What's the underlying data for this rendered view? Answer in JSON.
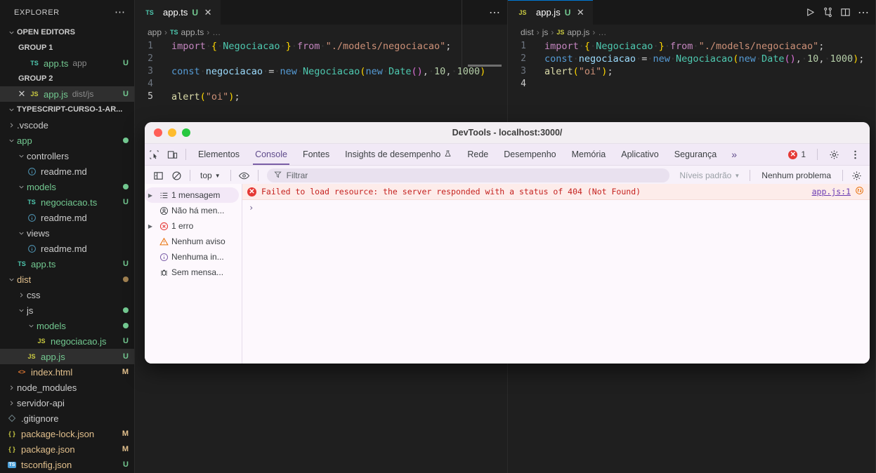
{
  "sidebar": {
    "title": "EXPLORER",
    "more_label": "⋯",
    "open_editors": {
      "label": "OPEN EDITORS",
      "groups": [
        {
          "label": "GROUP 1",
          "items": [
            {
              "icon": "ts-file-icon",
              "name": "app.ts",
              "path": "app",
              "badge": "U"
            }
          ]
        },
        {
          "label": "GROUP 2",
          "items": [
            {
              "icon": "js-file-icon",
              "name": "app.js",
              "path": "dist/js",
              "badge": "U",
              "close": "✕"
            }
          ]
        }
      ]
    },
    "project": {
      "label": "TYPESCRIPT-CURSO-1-AR...",
      "tree": [
        {
          "depth": 1,
          "kind": "folder",
          "collapsed": true,
          "name": ".vscode",
          "color": "plain",
          "badge": "",
          "dot": ""
        },
        {
          "depth": 1,
          "kind": "folder",
          "collapsed": false,
          "name": "app",
          "color": "green",
          "badge": "",
          "dot": "#73c991"
        },
        {
          "depth": 2,
          "kind": "folder",
          "collapsed": false,
          "name": "controllers",
          "color": "plain",
          "badge": "",
          "dot": ""
        },
        {
          "depth": 3,
          "kind": "md",
          "name": "readme.md",
          "color": "plain",
          "badge": "",
          "dot": ""
        },
        {
          "depth": 2,
          "kind": "folder",
          "collapsed": false,
          "name": "models",
          "color": "green",
          "badge": "",
          "dot": "#73c991"
        },
        {
          "depth": 3,
          "kind": "ts",
          "name": "negociacao.ts",
          "color": "green",
          "badge": "U",
          "dot": ""
        },
        {
          "depth": 3,
          "kind": "md",
          "name": "readme.md",
          "color": "plain",
          "badge": "",
          "dot": ""
        },
        {
          "depth": 2,
          "kind": "folder",
          "collapsed": false,
          "name": "views",
          "color": "plain",
          "badge": "",
          "dot": ""
        },
        {
          "depth": 3,
          "kind": "md",
          "name": "readme.md",
          "color": "plain",
          "badge": "",
          "dot": ""
        },
        {
          "depth": 2,
          "kind": "ts",
          "name": "app.ts",
          "color": "green",
          "badge": "U",
          "dot": ""
        },
        {
          "depth": 1,
          "kind": "folder",
          "collapsed": false,
          "name": "dist",
          "color": "orange",
          "badge": "",
          "dot": "#a08050"
        },
        {
          "depth": 2,
          "kind": "folder",
          "collapsed": true,
          "name": "css",
          "color": "plain",
          "badge": "",
          "dot": ""
        },
        {
          "depth": 2,
          "kind": "folder",
          "collapsed": false,
          "name": "js",
          "color": "plain",
          "badge": "",
          "dot": "#73c991"
        },
        {
          "depth": 3,
          "kind": "folder",
          "collapsed": false,
          "name": "models",
          "color": "green",
          "badge": "",
          "dot": "#73c991"
        },
        {
          "depth": 4,
          "kind": "js",
          "name": "negociacao.js",
          "color": "green",
          "badge": "U",
          "dot": ""
        },
        {
          "depth": 3,
          "kind": "js",
          "name": "app.js",
          "color": "green",
          "badge": "U",
          "dot": "",
          "selected": true
        },
        {
          "depth": 2,
          "kind": "html",
          "name": "index.html",
          "color": "orange",
          "badge": "M",
          "dot": ""
        },
        {
          "depth": 1,
          "kind": "folder",
          "collapsed": true,
          "name": "node_modules",
          "color": "plain",
          "badge": "",
          "dot": ""
        },
        {
          "depth": 1,
          "kind": "folder",
          "collapsed": true,
          "name": "servidor-api",
          "color": "plain",
          "badge": "",
          "dot": ""
        },
        {
          "depth": 1,
          "kind": "git",
          "name": ".gitignore",
          "color": "plain",
          "badge": "",
          "dot": ""
        },
        {
          "depth": 1,
          "kind": "json",
          "name": "package-lock.json",
          "color": "orange",
          "badge": "M",
          "dot": ""
        },
        {
          "depth": 1,
          "kind": "json",
          "name": "package.json",
          "color": "orange",
          "badge": "M",
          "dot": ""
        },
        {
          "depth": 1,
          "kind": "tsconf",
          "name": "tsconfig.json",
          "color": "orange",
          "badge": "U",
          "dot": ""
        }
      ]
    }
  },
  "editor_left": {
    "tab": {
      "icon": "ts-file-icon",
      "name": "app.ts",
      "badge": "U",
      "close": "✕"
    },
    "more_label": "⋯",
    "breadcrumb": [
      "app",
      "app.ts",
      "…"
    ],
    "lines": [
      {
        "n": "1",
        "tokens": [
          {
            "t": "import",
            "c": "k-import"
          },
          {
            "t": "·",
            "c": "ws"
          },
          {
            "t": "{",
            "c": "br-y"
          },
          {
            "t": "·",
            "c": "ws"
          },
          {
            "t": "Negociacao",
            "c": "id-cls"
          },
          {
            "t": "·",
            "c": "ws"
          },
          {
            "t": "}",
            "c": "br-y"
          },
          {
            "t": "·",
            "c": "ws"
          },
          {
            "t": "from",
            "c": "k-import"
          },
          {
            "t": "·",
            "c": "ws"
          },
          {
            "t": "\"./models/negociacao\"",
            "c": "str"
          },
          {
            "t": ";",
            "c": "punc"
          }
        ]
      },
      {
        "n": "2",
        "tokens": []
      },
      {
        "n": "3",
        "tokens": [
          {
            "t": "const",
            "c": "k-const"
          },
          {
            "t": "·",
            "c": "ws"
          },
          {
            "t": "negociacao",
            "c": "id-var"
          },
          {
            "t": "·",
            "c": "ws"
          },
          {
            "t": "=",
            "c": "punc"
          },
          {
            "t": "·",
            "c": "ws"
          },
          {
            "t": "new",
            "c": "k-new"
          },
          {
            "t": "·",
            "c": "ws"
          },
          {
            "t": "Negociacao",
            "c": "id-cls"
          },
          {
            "t": "(",
            "c": "br-y"
          },
          {
            "t": "new",
            "c": "k-new"
          },
          {
            "t": "·",
            "c": "ws"
          },
          {
            "t": "Date",
            "c": "id-cls"
          },
          {
            "t": "(",
            "c": "br-p"
          },
          {
            "t": ")",
            "c": "br-p"
          },
          {
            "t": ",",
            "c": "punc"
          },
          {
            "t": "·",
            "c": "ws"
          },
          {
            "t": "10",
            "c": "num"
          },
          {
            "t": ",",
            "c": "punc"
          },
          {
            "t": "·",
            "c": "ws"
          },
          {
            "t": "1000",
            "c": "num"
          },
          {
            "t": ")",
            "c": "br-y"
          }
        ]
      },
      {
        "n": "4",
        "tokens": []
      },
      {
        "n": "5",
        "cur": true,
        "tokens": [
          {
            "t": "alert",
            "c": "fn"
          },
          {
            "t": "(",
            "c": "br-y"
          },
          {
            "t": "\"oi\"",
            "c": "str"
          },
          {
            "t": ")",
            "c": "br-y"
          },
          {
            "t": ";",
            "c": "punc"
          }
        ]
      }
    ]
  },
  "editor_right": {
    "tab": {
      "icon": "js-file-icon",
      "name": "app.js",
      "badge": "U",
      "close": "✕"
    },
    "actions": [
      "run-icon",
      "source-control-icon",
      "split-editor-icon",
      "more-actions-icon"
    ],
    "breadcrumb": [
      "dist",
      "js",
      "app.js",
      "…"
    ],
    "lines": [
      {
        "n": "1",
        "tokens": [
          {
            "t": "import",
            "c": "k-import"
          },
          {
            "t": "·",
            "c": "ws"
          },
          {
            "t": "{",
            "c": "br-y"
          },
          {
            "t": "·",
            "c": "ws"
          },
          {
            "t": "Negociacao",
            "c": "id-cls"
          },
          {
            "t": "·",
            "c": "ws"
          },
          {
            "t": "}",
            "c": "br-y"
          },
          {
            "t": "·",
            "c": "ws"
          },
          {
            "t": "from",
            "c": "k-import"
          },
          {
            "t": "·",
            "c": "ws"
          },
          {
            "t": "\"./models/negociacao\"",
            "c": "str"
          },
          {
            "t": ";",
            "c": "punc"
          }
        ]
      },
      {
        "n": "2",
        "tokens": [
          {
            "t": "const",
            "c": "k-const"
          },
          {
            "t": "·",
            "c": "ws"
          },
          {
            "t": "negociacao",
            "c": "id-var"
          },
          {
            "t": "·",
            "c": "ws"
          },
          {
            "t": "=",
            "c": "punc"
          },
          {
            "t": "·",
            "c": "ws"
          },
          {
            "t": "new",
            "c": "k-new"
          },
          {
            "t": "·",
            "c": "ws"
          },
          {
            "t": "Negociacao",
            "c": "id-cls"
          },
          {
            "t": "(",
            "c": "br-y"
          },
          {
            "t": "new",
            "c": "k-new"
          },
          {
            "t": "·",
            "c": "ws"
          },
          {
            "t": "Date",
            "c": "id-cls"
          },
          {
            "t": "(",
            "c": "br-p"
          },
          {
            "t": ")",
            "c": "br-p"
          },
          {
            "t": ",",
            "c": "punc"
          },
          {
            "t": "·",
            "c": "ws"
          },
          {
            "t": "10",
            "c": "num"
          },
          {
            "t": ",",
            "c": "punc"
          },
          {
            "t": "·",
            "c": "ws"
          },
          {
            "t": "1000",
            "c": "num"
          },
          {
            "t": ")",
            "c": "br-y"
          },
          {
            "t": ";",
            "c": "punc"
          }
        ]
      },
      {
        "n": "3",
        "tokens": [
          {
            "t": "alert",
            "c": "fn"
          },
          {
            "t": "(",
            "c": "br-y"
          },
          {
            "t": "\"oi\"",
            "c": "str"
          },
          {
            "t": ")",
            "c": "br-y"
          },
          {
            "t": ";",
            "c": "punc"
          }
        ]
      },
      {
        "n": "4",
        "cur": true,
        "tokens": []
      }
    ]
  },
  "devtools": {
    "window_title": "DevTools - localhost:3000/",
    "tabs": [
      {
        "label": "Elementos",
        "active": false
      },
      {
        "label": "Console",
        "active": true
      },
      {
        "label": "Fontes",
        "active": false
      },
      {
        "label": "Insights de desempenho",
        "active": false,
        "flask": true
      },
      {
        "label": "Rede",
        "active": false
      },
      {
        "label": "Desempenho",
        "active": false
      },
      {
        "label": "Memória",
        "active": false
      },
      {
        "label": "Aplicativo",
        "active": false
      },
      {
        "label": "Segurança",
        "active": false
      }
    ],
    "overflow_label": "»",
    "error_count": "1",
    "toolbar": {
      "context": "top",
      "filter_placeholder": "Filtrar",
      "levels_label": "Níveis padrão",
      "issues_label": "Nenhum problema"
    },
    "sidebar": [
      {
        "icon": "list-icon",
        "label": "1 mensagem",
        "arrow": true,
        "active": true
      },
      {
        "icon": "user-icon",
        "label": "Não há men...",
        "arrow": false,
        "active": false
      },
      {
        "icon": "error-icon",
        "label": "1 erro",
        "arrow": true,
        "active": false
      },
      {
        "icon": "warning-icon",
        "label": "Nenhum aviso",
        "arrow": false,
        "active": false
      },
      {
        "icon": "info-icon",
        "label": "Nenhuma in...",
        "arrow": false,
        "active": false
      },
      {
        "icon": "bug-icon",
        "label": "Sem mensa...",
        "arrow": false,
        "active": false
      }
    ],
    "messages": [
      {
        "level": "error",
        "text": "Failed to load resource: the server responded with a status of 404 (Not Found)",
        "source": "app.js:1"
      }
    ],
    "prompt_symbol": "›"
  }
}
